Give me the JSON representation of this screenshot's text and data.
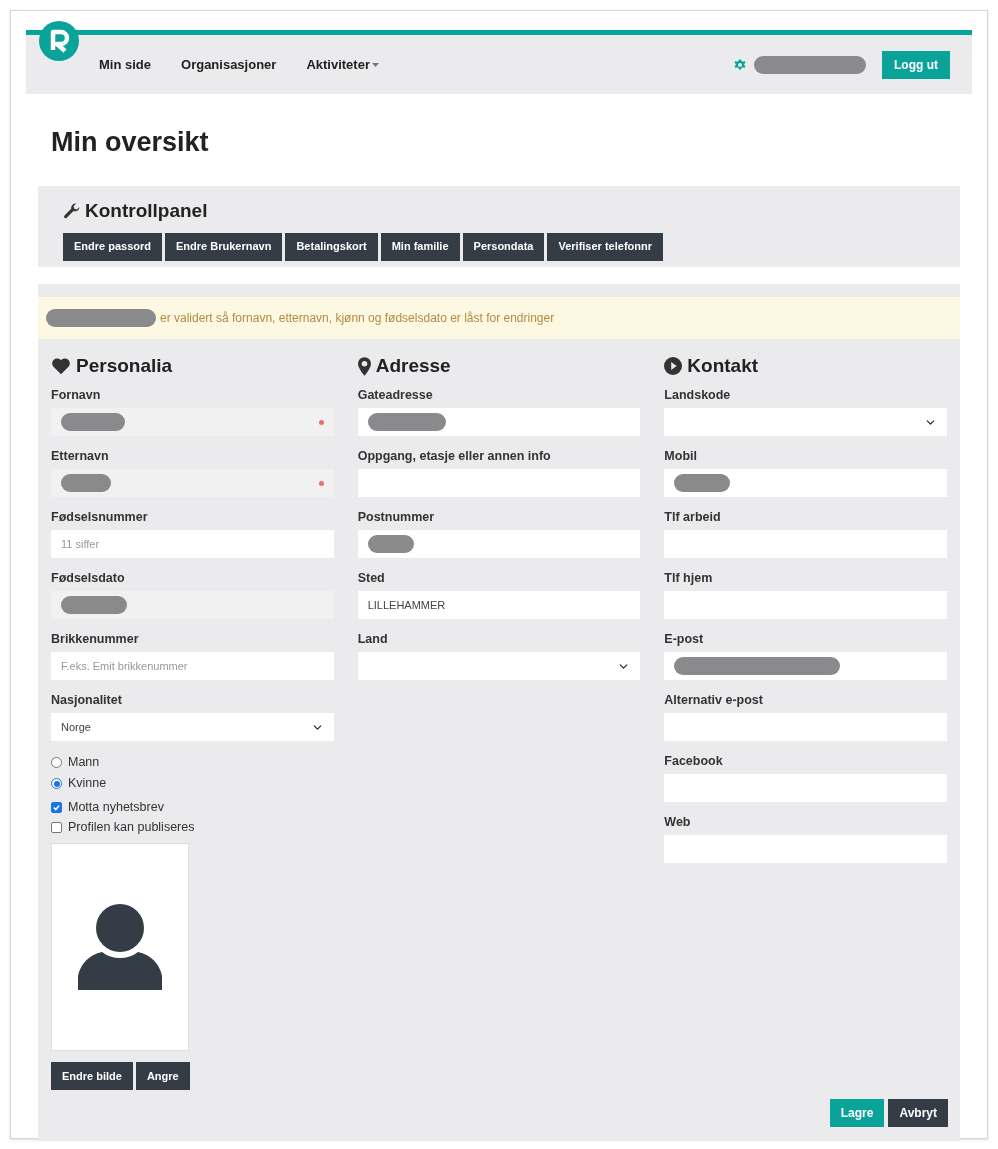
{
  "nav": {
    "items": [
      {
        "label": "Min side",
        "dropdown": false
      },
      {
        "label": "Organisasjoner",
        "dropdown": false
      },
      {
        "label": "Aktiviteter",
        "dropdown": true
      }
    ],
    "user_redacted": true,
    "logout": "Logg ut"
  },
  "page_title": "Min oversikt",
  "control_panel": {
    "title": "Kontrollpanel",
    "buttons": [
      "Endre passord",
      "Endre Brukernavn",
      "Betalingskort",
      "Min familie",
      "Persondata",
      "Verifiser telefonnr"
    ]
  },
  "notice": {
    "subject_redacted": true,
    "text": "er validert så fornavn, etternavn, kjønn og fødselsdato er låst for endringer"
  },
  "sections": [
    {
      "title": "Personalia",
      "fields": [
        {
          "label": "Fornavn",
          "kind": "input",
          "redacted": true,
          "locked": true,
          "required": true
        },
        {
          "label": "Etternavn",
          "kind": "input",
          "redacted": true,
          "locked": true,
          "required": true
        },
        {
          "label": "Fødselsnummer",
          "kind": "input",
          "placeholder": "11 siffer",
          "redacted": false,
          "locked": false,
          "required": false
        },
        {
          "label": "Fødselsdato",
          "kind": "input",
          "redacted": true,
          "locked": true,
          "required": false
        },
        {
          "label": "Brikkenummer",
          "kind": "input",
          "placeholder": "F.eks. Emit brikkenummer",
          "redacted": false,
          "locked": false,
          "required": false
        },
        {
          "label": "Nasjonalitet",
          "kind": "select",
          "value": "Norge",
          "redacted": false,
          "locked": false,
          "required": false
        }
      ]
    },
    {
      "title": "Adresse",
      "fields": [
        {
          "label": "Gateadresse",
          "kind": "input",
          "redacted": true,
          "locked": false,
          "required": false
        },
        {
          "label": "Oppgang, etasje eller annen info",
          "kind": "input",
          "redacted": false,
          "locked": false,
          "required": false
        },
        {
          "label": "Postnummer",
          "kind": "input",
          "redacted": true,
          "locked": false,
          "required": false
        },
        {
          "label": "Sted",
          "kind": "input",
          "value": "LILLEHAMMER",
          "redacted": false,
          "locked": false,
          "required": false
        },
        {
          "label": "Land",
          "kind": "select",
          "redacted": false,
          "locked": false,
          "required": false
        }
      ]
    },
    {
      "title": "Kontakt",
      "fields": [
        {
          "label": "Landskode",
          "kind": "select",
          "redacted": false,
          "locked": false,
          "required": false
        },
        {
          "label": "Mobil",
          "kind": "input",
          "redacted": true,
          "locked": false,
          "required": false
        },
        {
          "label": "Tlf arbeid",
          "kind": "input",
          "redacted": false,
          "locked": false,
          "required": false
        },
        {
          "label": "Tlf hjem",
          "kind": "input",
          "redacted": false,
          "locked": false,
          "required": false
        },
        {
          "label": "E-post",
          "kind": "input",
          "redacted": true,
          "locked": false,
          "required": false
        },
        {
          "label": "Alternativ e-post",
          "kind": "input",
          "redacted": false,
          "locked": false,
          "required": false
        },
        {
          "label": "Facebook",
          "kind": "input",
          "redacted": false,
          "locked": false,
          "required": false
        },
        {
          "label": "Web",
          "kind": "input",
          "redacted": false,
          "locked": false,
          "required": false
        }
      ]
    }
  ],
  "gender": [
    {
      "label": "Mann",
      "selected": false
    },
    {
      "label": "Kvinne",
      "selected": true
    }
  ],
  "checkboxes": [
    {
      "label": "Motta nyhetsbrev",
      "checked": true
    },
    {
      "label": "Profilen kan publiseres",
      "checked": false
    }
  ],
  "photo_buttons": [
    "Endre bilde",
    "Angre"
  ],
  "actions": [
    {
      "label": "Lagre",
      "kind": "primary"
    },
    {
      "label": "Avbryt",
      "kind": "secondary"
    }
  ]
}
